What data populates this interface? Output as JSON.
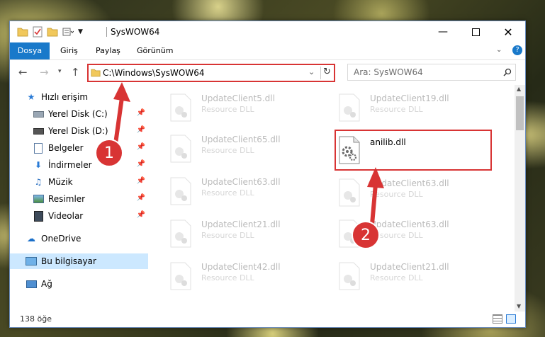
{
  "window": {
    "title": "SysWOW64"
  },
  "ribbon": {
    "tabs": [
      "Dosya",
      "Giriş",
      "Paylaş",
      "Görünüm"
    ]
  },
  "address": {
    "path": "C:\\Windows\\SysWOW64"
  },
  "search": {
    "placeholder": "Ara: SysWOW64"
  },
  "sidebar": {
    "items": [
      {
        "label": "Hızlı erişim"
      },
      {
        "label": "Yerel Disk (C:)"
      },
      {
        "label": "Yerel Disk (D:)"
      },
      {
        "label": "Belgeler"
      },
      {
        "label": "İndirmeler"
      },
      {
        "label": "Müzik"
      },
      {
        "label": "Resimler"
      },
      {
        "label": "Videolar"
      },
      {
        "label": "OneDrive"
      },
      {
        "label": "Bu bilgisayar"
      },
      {
        "label": "Ağ"
      }
    ]
  },
  "files": {
    "left": [
      {
        "name": "UpdateClient5.dll",
        "type": "Resource DLL"
      },
      {
        "name": "UpdateClient65.dll",
        "type": "Resource DLL"
      },
      {
        "name": "UpdateClient63.dll",
        "type": "Resource DLL"
      },
      {
        "name": "UpdateClient21.dll",
        "type": "Resource DLL"
      },
      {
        "name": "UpdateClient42.dll",
        "type": "Resource DLL"
      }
    ],
    "right": [
      {
        "name": "UpdateClient19.dll",
        "type": "Resource DLL"
      },
      {
        "name": "anilib.dll",
        "type": ""
      },
      {
        "name": "UpdateClient63.dll",
        "type": "Resource DLL"
      },
      {
        "name": "UpdateClient63.dll",
        "type": "Resource DLL"
      },
      {
        "name": "UpdateClient21.dll",
        "type": "Resource DLL"
      }
    ]
  },
  "status": {
    "count": "138 öğe"
  },
  "callouts": {
    "one": "1",
    "two": "2"
  },
  "colors": {
    "accent": "#1979ca",
    "highlight": "#d83434",
    "selected": "#cce8ff"
  }
}
